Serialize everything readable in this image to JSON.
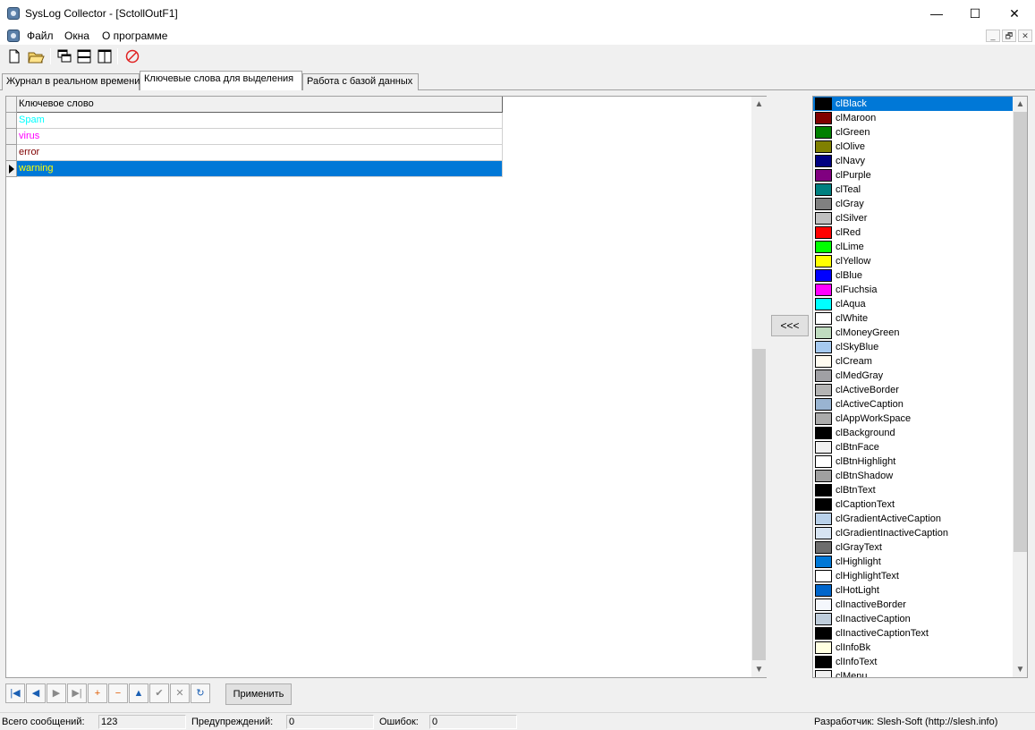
{
  "window": {
    "title": "SysLog Collector - [SctollOutF1]"
  },
  "window_controls": {
    "minimize": "—",
    "maximize": "☐",
    "close": "✕"
  },
  "menu": {
    "items": [
      "Файл",
      "Окна",
      "О программе"
    ]
  },
  "mdi_controls": [
    "_",
    "🗗",
    "✕"
  ],
  "toolbar": {
    "buttons": [
      {
        "name": "new-icon"
      },
      {
        "name": "open-folder-icon"
      },
      {
        "name": "cascade-icon"
      },
      {
        "name": "tile-horizontal-icon"
      },
      {
        "name": "tile-vertical-icon"
      },
      {
        "name": "stop-icon"
      }
    ]
  },
  "tabs": [
    {
      "label": "Журнал в реальном времени",
      "active": false
    },
    {
      "label": "Ключевые слова для выделения",
      "active": true
    },
    {
      "label": "Работа с базой данных",
      "active": false
    }
  ],
  "grid": {
    "header": "Ключевое слово",
    "rows": [
      {
        "text": "Spam",
        "color": "#00ffff",
        "selected": false
      },
      {
        "text": "virus",
        "color": "#ff00ff",
        "selected": false
      },
      {
        "text": "error",
        "color": "#800000",
        "selected": false
      },
      {
        "text": "warning",
        "color": "#ffff00",
        "selected": true
      }
    ]
  },
  "move_button": "<<<",
  "colors": [
    {
      "name": "clBlack",
      "hex": "#000000",
      "selected": true
    },
    {
      "name": "clMaroon",
      "hex": "#800000"
    },
    {
      "name": "clGreen",
      "hex": "#008000"
    },
    {
      "name": "clOlive",
      "hex": "#808000"
    },
    {
      "name": "clNavy",
      "hex": "#000080"
    },
    {
      "name": "clPurple",
      "hex": "#800080"
    },
    {
      "name": "clTeal",
      "hex": "#008080"
    },
    {
      "name": "clGray",
      "hex": "#808080"
    },
    {
      "name": "clSilver",
      "hex": "#c0c0c0"
    },
    {
      "name": "clRed",
      "hex": "#ff0000"
    },
    {
      "name": "clLime",
      "hex": "#00ff00"
    },
    {
      "name": "clYellow",
      "hex": "#ffff00"
    },
    {
      "name": "clBlue",
      "hex": "#0000ff"
    },
    {
      "name": "clFuchsia",
      "hex": "#ff00ff"
    },
    {
      "name": "clAqua",
      "hex": "#00ffff"
    },
    {
      "name": "clWhite",
      "hex": "#ffffff"
    },
    {
      "name": "clMoneyGreen",
      "hex": "#c0dcc0"
    },
    {
      "name": "clSkyBlue",
      "hex": "#a6caf0"
    },
    {
      "name": "clCream",
      "hex": "#fffbf0"
    },
    {
      "name": "clMedGray",
      "hex": "#a0a0a4"
    },
    {
      "name": "clActiveBorder",
      "hex": "#b4b4b4"
    },
    {
      "name": "clActiveCaption",
      "hex": "#99b4d1"
    },
    {
      "name": "clAppWorkSpace",
      "hex": "#ababab"
    },
    {
      "name": "clBackground",
      "hex": "#000000"
    },
    {
      "name": "clBtnFace",
      "hex": "#f0f0f0"
    },
    {
      "name": "clBtnHighlight",
      "hex": "#ffffff"
    },
    {
      "name": "clBtnShadow",
      "hex": "#a0a0a0"
    },
    {
      "name": "clBtnText",
      "hex": "#000000"
    },
    {
      "name": "clCaptionText",
      "hex": "#000000"
    },
    {
      "name": "clGradientActiveCaption",
      "hex": "#b9d1ea"
    },
    {
      "name": "clGradientInactiveCaption",
      "hex": "#d7e4f2"
    },
    {
      "name": "clGrayText",
      "hex": "#6d6d6d"
    },
    {
      "name": "clHighlight",
      "hex": "#0078d7"
    },
    {
      "name": "clHighlightText",
      "hex": "#ffffff"
    },
    {
      "name": "clHotLight",
      "hex": "#0066cc"
    },
    {
      "name": "clInactiveBorder",
      "hex": "#f4f7fc"
    },
    {
      "name": "clInactiveCaption",
      "hex": "#bfcddb"
    },
    {
      "name": "clInactiveCaptionText",
      "hex": "#000000"
    },
    {
      "name": "clInfoBk",
      "hex": "#ffffe1"
    },
    {
      "name": "clInfoText",
      "hex": "#000000"
    },
    {
      "name": "clMenu",
      "hex": "#f0f0f0"
    }
  ],
  "navigator": {
    "buttons": [
      {
        "name": "first-record-icon",
        "glyph": "|◀"
      },
      {
        "name": "prior-record-icon",
        "glyph": "◀"
      },
      {
        "name": "next-record-icon",
        "glyph": "▶"
      },
      {
        "name": "last-record-icon",
        "glyph": "▶|"
      },
      {
        "name": "insert-record-icon",
        "glyph": "+"
      },
      {
        "name": "delete-record-icon",
        "glyph": "−"
      },
      {
        "name": "edit-record-icon",
        "glyph": "▲"
      },
      {
        "name": "post-record-icon",
        "glyph": "✔"
      },
      {
        "name": "cancel-record-icon",
        "glyph": "✕"
      },
      {
        "name": "refresh-record-icon",
        "glyph": "↻"
      }
    ],
    "apply_label": "Применить"
  },
  "status": {
    "total_label": "Всего сообщений:",
    "total_value": "123",
    "warnings_label": "Предупреждений:",
    "warnings_value": "0",
    "errors_label": "Ошибок:",
    "errors_value": "0",
    "developer": "Разработчик: Slesh-Soft (http://slesh.info)"
  }
}
